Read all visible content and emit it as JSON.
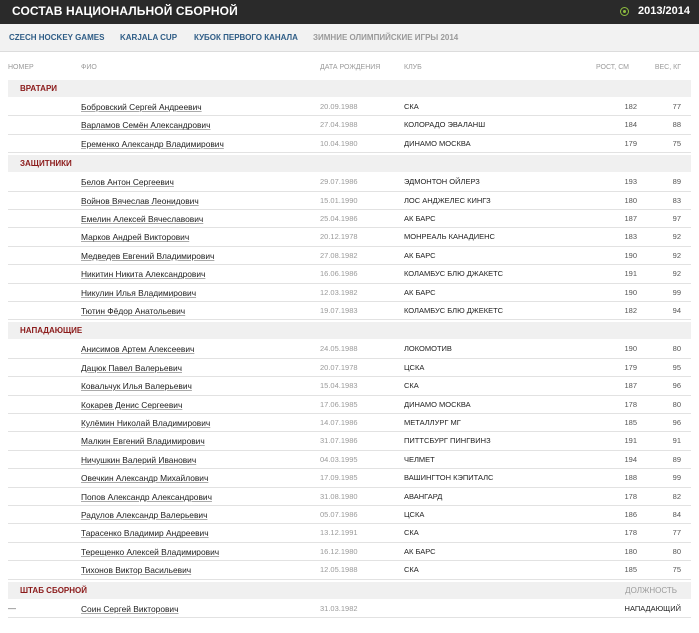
{
  "header": {
    "title": "СОСТАВ НАЦИОНАЛЬНОЙ СБОРНОЙ",
    "season": "2013/2014",
    "accent_color": "#8b1a1a",
    "tab_color": "#2f5d86"
  },
  "tabs": [
    {
      "label": "CZECH HOCKEY GAMES",
      "active": true
    },
    {
      "label": "KARJALA CUP",
      "active": true
    },
    {
      "label": "КУБОК ПЕРВОГО КАНАЛА",
      "active": true
    },
    {
      "label": "ЗИМНИЕ ОЛИМПИЙСКИЕ ИГРЫ 2014",
      "active": false
    }
  ],
  "columns": {
    "number": "НОМЕР",
    "name": "ФИО",
    "dob": "ДАТА РОЖДЕНИЯ",
    "club": "КЛУБ",
    "height": "РОСТ, СМ",
    "weight": "ВЕС, КГ"
  },
  "sections": [
    {
      "label": "ВРАТАРИ",
      "rows": [
        {
          "name": "Бобровский Сергей Андреевич",
          "dob": "20.09.1988",
          "club": "СКА",
          "height": "182",
          "weight": "77"
        },
        {
          "name": "Варламов Семён Александрович",
          "dob": "27.04.1988",
          "club": "КОЛОРАДО ЭВАЛАНШ",
          "height": "184",
          "weight": "88"
        },
        {
          "name": "Еременко Александр Владимирович",
          "dob": "10.04.1980",
          "club": "ДИНАМО МОСКВА",
          "height": "179",
          "weight": "75"
        }
      ]
    },
    {
      "label": "ЗАЩИТНИКИ",
      "rows": [
        {
          "name": "Белов Антон Сергеевич",
          "dob": "29.07.1986",
          "club": "ЭДМОНТОН ОЙЛЕРЗ",
          "height": "193",
          "weight": "89"
        },
        {
          "name": "Войнов Вячеслав Леонидович",
          "dob": "15.01.1990",
          "club": "ЛОС АНДЖЕЛЕС КИНГЗ",
          "height": "180",
          "weight": "83"
        },
        {
          "name": "Емелин Алексей Вячеславович",
          "dob": "25.04.1986",
          "club": "АК БАРС",
          "height": "187",
          "weight": "97"
        },
        {
          "name": "Марков Андрей Викторович",
          "dob": "20.12.1978",
          "club": "МОНРЕАЛЬ КАНАДИЕНС",
          "height": "183",
          "weight": "92"
        },
        {
          "name": "Медведев Евгений Владимирович",
          "dob": "27.08.1982",
          "club": "АК БАРС",
          "height": "190",
          "weight": "92"
        },
        {
          "name": "Никитин Никита Александрович",
          "dob": "16.06.1986",
          "club": "КОЛАМБУС БЛЮ ДЖАКЕТС",
          "height": "191",
          "weight": "92"
        },
        {
          "name": "Никулин Илья Владимирович",
          "dob": "12.03.1982",
          "club": "АК БАРС",
          "height": "190",
          "weight": "99"
        },
        {
          "name": "Тютин Фёдор Анатольевич",
          "dob": "19.07.1983",
          "club": "КОЛАМБУС БЛЮ ДЖЕКЕТС",
          "height": "182",
          "weight": "94"
        }
      ]
    },
    {
      "label": "НАПАДАЮЩИЕ",
      "rows": [
        {
          "name": "Анисимов Артем Алексеевич",
          "dob": "24.05.1988",
          "club": "ЛОКОМОТИВ",
          "height": "190",
          "weight": "80"
        },
        {
          "name": "Дацюк Павел Валерьевич",
          "dob": "20.07.1978",
          "club": "ЦСКА",
          "height": "179",
          "weight": "95"
        },
        {
          "name": "Ковальчук Илья Валерьевич",
          "dob": "15.04.1983",
          "club": "СКА",
          "height": "187",
          "weight": "96"
        },
        {
          "name": "Кокарев Денис Сергеевич",
          "dob": "17.06.1985",
          "club": "ДИНАМО МОСКВА",
          "height": "178",
          "weight": "80"
        },
        {
          "name": "Кулёмин Николай Владимирович",
          "dob": "14.07.1986",
          "club": "МЕТАЛЛУРГ МГ",
          "height": "185",
          "weight": "96"
        },
        {
          "name": "Малкин Евгений Владимирович",
          "dob": "31.07.1986",
          "club": "ПИТТСБУРГ ПИНГВИНЗ",
          "height": "191",
          "weight": "91"
        },
        {
          "name": "Ничушкин Валерий Иванович",
          "dob": "04.03.1995",
          "club": "ЧЕЛМЕТ",
          "height": "194",
          "weight": "89"
        },
        {
          "name": "Овечкин Александр Михайлович",
          "dob": "17.09.1985",
          "club": "ВАШИНГТОН КЭПИТАЛС",
          "height": "188",
          "weight": "99"
        },
        {
          "name": "Попов Александр Александрович",
          "dob": "31.08.1980",
          "club": "АВАНГАРД",
          "height": "178",
          "weight": "82"
        },
        {
          "name": "Радулов Александр Валерьевич",
          "dob": "05.07.1986",
          "club": "ЦСКА",
          "height": "186",
          "weight": "84"
        },
        {
          "name": "Тарасенко Владимир Андреевич",
          "dob": "13.12.1991",
          "club": "СКА",
          "height": "178",
          "weight": "77"
        },
        {
          "name": "Терещенко Алексей Владимирович",
          "dob": "16.12.1980",
          "club": "АК БАРС",
          "height": "180",
          "weight": "80"
        },
        {
          "name": "Тихонов Виктор Васильевич",
          "dob": "12.05.1988",
          "club": "СКА",
          "height": "185",
          "weight": "75"
        }
      ]
    }
  ],
  "staff": {
    "label": "ШТАБ СБОРНОЙ",
    "position_header": "ДОЛЖНОСТЬ",
    "rows": [
      {
        "number": "—",
        "name": "Соин Сергей Викторович",
        "dob": "31.03.1982",
        "position": "НАПАДАЮЩИЙ"
      }
    ]
  }
}
